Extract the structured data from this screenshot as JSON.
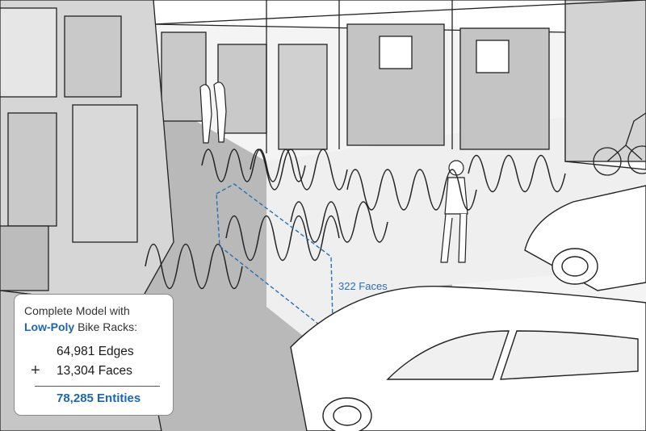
{
  "scene": {
    "faces_callout": "322 Faces",
    "colors": {
      "accent": "#1c67b1",
      "callout": "#2a6fb5",
      "shadow": "#b9b9b9",
      "wall": "#d8d8d8"
    }
  },
  "stats": {
    "title_line1": "Complete Model with",
    "title_accent": "Low-Poly",
    "title_rest": "Bike Racks:",
    "edges": "64,981 Edges",
    "plus_sign": "+",
    "faces": "13,304 Faces",
    "total": "78,285 Entities"
  }
}
